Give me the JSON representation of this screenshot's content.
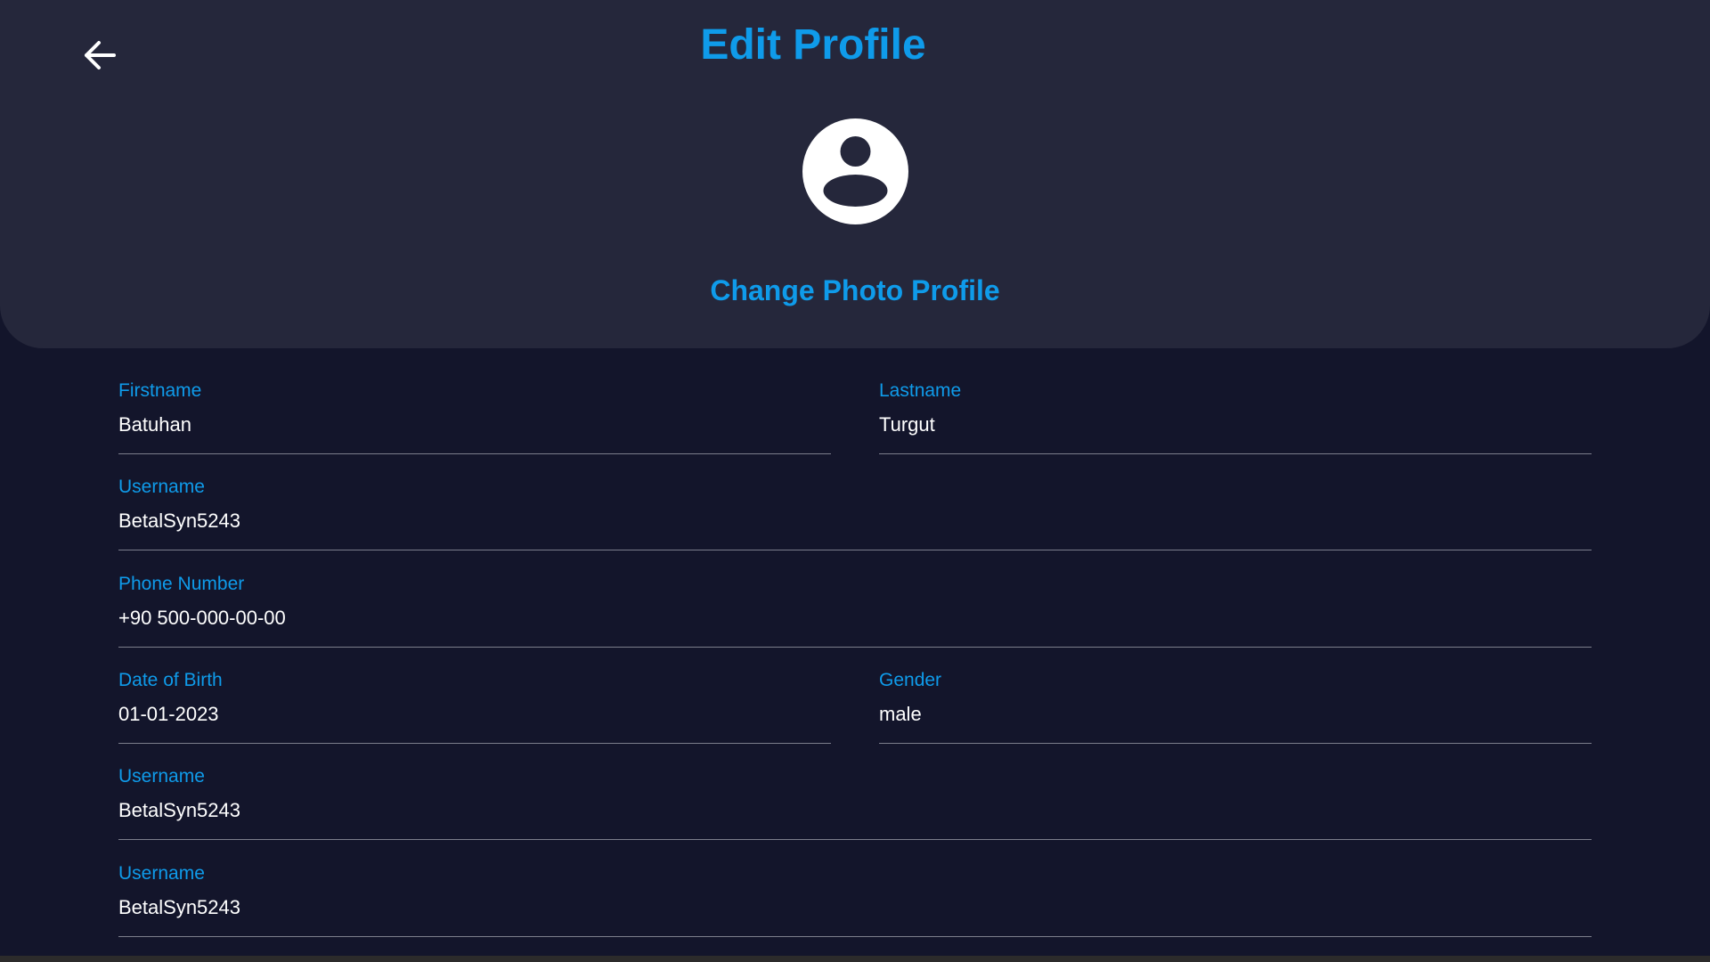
{
  "header": {
    "title": "Edit Profile",
    "back_icon": "arrow-left-icon",
    "avatar_icon": "user-circle-icon",
    "change_photo_label": "Change Photo Profile"
  },
  "form": {
    "firstname": {
      "label": "Firstname",
      "value": "Batuhan"
    },
    "lastname": {
      "label": "Lastname",
      "value": "Turgut"
    },
    "username": {
      "label": "Username",
      "value": "BetalSyn5243"
    },
    "phone": {
      "label": "Phone Number",
      "value": "+90 500-000-00-00"
    },
    "dob": {
      "label": "Date of Birth",
      "value": "01-01-2023"
    },
    "gender": {
      "label": "Gender",
      "value": "male"
    },
    "username_2": {
      "label": "Username",
      "value": "BetalSyn5243"
    },
    "username_3": {
      "label": "Username",
      "value": "BetalSyn5243"
    }
  },
  "colors": {
    "accent": "#0f9bea",
    "header_bg": "#25273b",
    "page_bg": "#13152b",
    "text": "#ffffff",
    "underline": "#7c7e8c"
  }
}
